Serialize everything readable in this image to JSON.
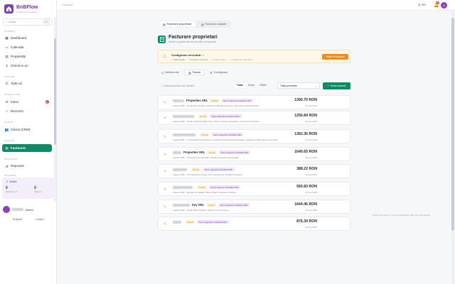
{
  "brand": {
    "name": "BnBFlow",
    "subtitle": "Conducere Rezidenta"
  },
  "sidebar": {
    "search_placeholder": "Caută...",
    "search_kbd": "⌘K",
    "sections": {
      "general": "GENERAL",
      "tasks": "TASKURI",
      "comm": "COMUNICARE",
      "clients": "CLIENȚI",
      "finance": "FINANȚE",
      "reports": "RAPOARTE",
      "progress": "PROGRES"
    },
    "items": {
      "dashboard": "Dashboard",
      "calendar": "Calendar",
      "properties": "Proprietăți",
      "checkin": "Check-in-uri",
      "tasks": "Task-uri",
      "inbox": "Inbox",
      "inbox_badge": "4",
      "reviews": "Recenzii",
      "crm": "Clienți (CRM)",
      "invoices": "Facturare",
      "reports": "Rapoarte"
    },
    "progress": {
      "title": "Astăzi",
      "left_value": "0",
      "left_label": "Check-in-uri",
      "right_value": "0",
      "right_label": "Task-uri"
    },
    "user": {
      "name_suffix": "Demo"
    },
    "footer": {
      "help": "Ajutor",
      "logout": "Ieșire"
    }
  },
  "topbar": {
    "breadcrumb": "Facturare",
    "lang": "RO",
    "notif_count": "10",
    "avatar": "A"
  },
  "page_tabs": [
    {
      "label": "Facturare proprietari"
    },
    {
      "label": "Facturare oaspeți"
    }
  ],
  "page": {
    "title": "Facturare proprietari",
    "subtitle": "Vedeți și gestionați facturi către proprietari"
  },
  "alert": {
    "title": "Configurare necesară",
    "title_note": "2/4",
    "checks": [
      "Date fiscale",
      "Furnizor conectat",
      "Seriei emitere",
      "Configurare proprietari"
    ],
    "button": "Setări eFacturare"
  },
  "sub_tabs": [
    {
      "label": "Nefacturate"
    },
    {
      "label": "Facturi"
    },
    {
      "label": "Configurare"
    }
  ],
  "toolbar": {
    "search_placeholder": "Caută proprietar sau factură...",
    "filters": [
      "Toate",
      "Emise",
      "Plătite"
    ],
    "select": "Toate proiectele",
    "add": "Emite factură"
  },
  "invoices": [
    {
      "name": "Properties SRL",
      "status": "Emisă",
      "owner": "Demo Agentie Imobiliara SRL",
      "meta": "August 2026 · Penthouse Victoriei, Apartament Regal Cotroceni, Garsoniera Kiseleff Pipera",
      "amount": "1390.70 RON",
      "date": "30 sep 2026"
    },
    {
      "name": "",
      "status": "Emisă",
      "owner": "Demo Agentie Imobiliara SRL",
      "meta": "August 2026 · Studio Herastrau Park View, Studio Victoriei Herastrau, Loft Cotroceni Grand",
      "amount": "1256.84 RON",
      "date": "30 sep 2026"
    },
    {
      "name": "",
      "status": "Ciornă",
      "owner": "Demo Agentie Imobiliara SRL",
      "meta": "August 2026 · Loft Kiseleff Vie Residence, Apartament Panoramic Floreasca, Apartament Baneasa Central Sky",
      "amount": "1362.36 RON",
      "date": "30 sep 2026"
    },
    {
      "name": "Properties SRL",
      "status": "Ciornă",
      "owner": "Demo Agentie Imobiliara SRL",
      "meta": "August 2026 · Garsoniera Central Parc, Studio Aviatorilor Promenada",
      "amount": "1640.65 RON",
      "date": "30 sep 2026"
    },
    {
      "name": "",
      "status": "Emisă",
      "owner": "Demo Agentie Imobiliara SRL",
      "meta": "August 2026 · Loft Herastrau Unique One, Apartament Vintage Dorobanti",
      "amount": "388.22 RON",
      "date": "30 sep 2026"
    },
    {
      "name": "",
      "status": "Ciornă",
      "owner": "Demo Agentie Imobiliara SRL",
      "meta": "August 2026 · Apartament Natalie Plaza, Duplex Herastrau Palette",
      "amount": "560.83 RON",
      "date": "30 sep 2026"
    },
    {
      "name": "Key SRL",
      "status": "Ciornă",
      "owner": "Demo Agentie Imobiliara SRL",
      "meta": "August 2026 · Studio Bistro Quarter, Studio Cotroceni Nest",
      "amount": "1644.46 RON",
      "date": "30 sep 2026"
    },
    {
      "name": "",
      "status": "Emisă",
      "owner": "Demo Agentie Imobiliara SRL",
      "meta": "",
      "amount": "876.39 RON",
      "date": "30 sep 2026"
    }
  ],
  "toast": "Poate dura 10-15 s - Se pot actualiza ți date ale proprietarilor",
  "colors": {
    "accent": "#0f8a66",
    "brand": "#7b3fb8",
    "warn": "#f08a1c"
  }
}
